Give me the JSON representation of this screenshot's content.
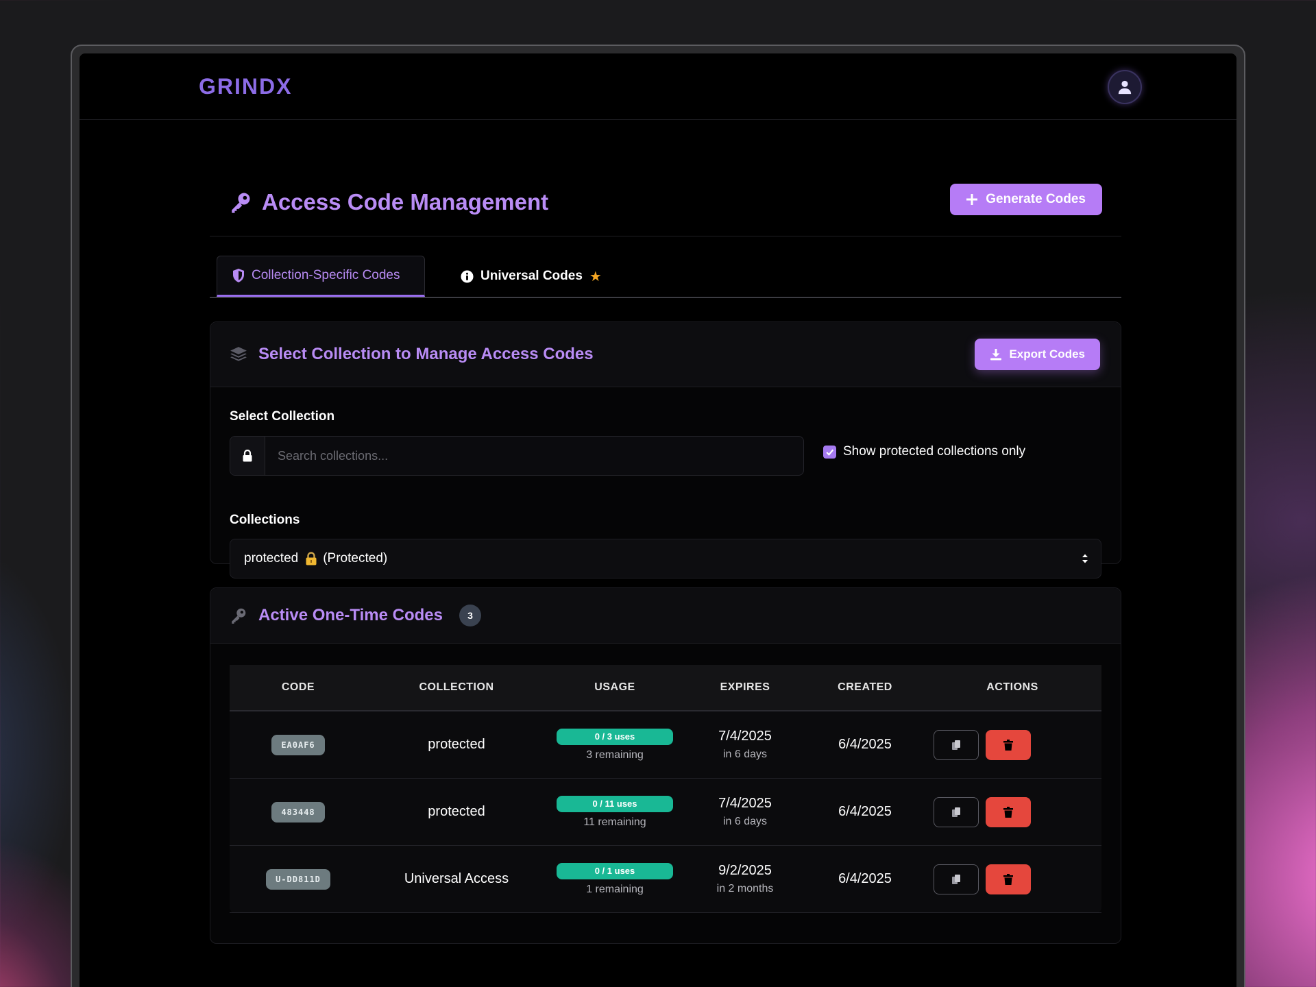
{
  "app": {
    "logo": "GRINDX"
  },
  "page": {
    "title": "Access Code Management",
    "generate_button": "Generate Codes"
  },
  "tabs": [
    {
      "label": "Collection-Specific Codes",
      "active": true,
      "icon": "shield-icon"
    },
    {
      "label": "Universal Codes",
      "active": false,
      "icon": "info-icon",
      "suffix_icon": "star-icon"
    }
  ],
  "select_card": {
    "title": "Select Collection to Manage Access Codes",
    "export_button": "Export Codes",
    "select_collection_label": "Select Collection",
    "search_placeholder": "Search collections...",
    "checkbox_label": "Show protected collections only",
    "checkbox_checked": true,
    "collections_label": "Collections",
    "selected_collection_name": "protected",
    "selected_collection_suffix": "(Protected)",
    "selected_collection_icon": "lock-emoji-icon"
  },
  "codes_card": {
    "title": "Active One-Time Codes",
    "count": "3",
    "columns": [
      "CODE",
      "COLLECTION",
      "USAGE",
      "EXPIRES",
      "CREATED",
      "ACTIONS"
    ],
    "rows": [
      {
        "code": "EA0AF6",
        "collection": "protected",
        "usage": "0 / 3 uses",
        "remaining": "3 remaining",
        "expires": "7/4/2025",
        "expires_rel": "in 6 days",
        "created": "6/4/2025"
      },
      {
        "code": "483448",
        "collection": "protected",
        "usage": "0 / 11 uses",
        "remaining": "11 remaining",
        "expires": "7/4/2025",
        "expires_rel": "in 6 days",
        "created": "6/4/2025"
      },
      {
        "code": "U-DD811D",
        "collection": "Universal Access",
        "usage": "0 / 1 uses",
        "remaining": "1 remaining",
        "expires": "9/2/2025",
        "expires_rel": "in 2 months",
        "created": "6/4/2025"
      }
    ]
  },
  "colors": {
    "accent": "#b67cf6",
    "accent_text": "#b98cf5",
    "success": "#19b895",
    "danger": "#e5473d",
    "star": "#f5a623"
  }
}
